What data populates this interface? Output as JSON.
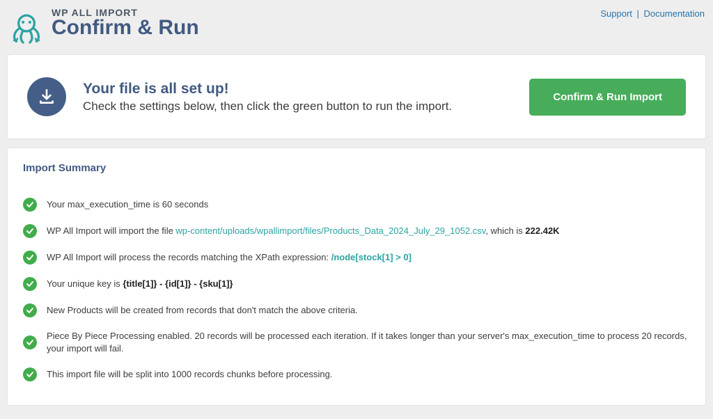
{
  "header": {
    "kicker": "WP ALL IMPORT",
    "title": "Confirm & Run",
    "support_label": "Support",
    "documentation_label": "Documentation",
    "separator": "|"
  },
  "setup": {
    "title": "Your file is all set up!",
    "subtitle": "Check the settings below, then click the green button to run the import.",
    "run_button_label": "Confirm & Run Import"
  },
  "summary": {
    "title": "Import Summary",
    "items": {
      "max_exec_pre": "Your max_execution_time is ",
      "max_exec_val": "60 seconds",
      "import_file_pre": "WP All Import will import the file ",
      "import_file_path": "wp-content/uploads/wpallimport/files/Products_Data_2024_July_29_1052.csv",
      "import_file_mid": ", which is ",
      "import_file_size": "222.42K",
      "xpath_pre": "WP All Import will process the records matching the XPath expression: ",
      "xpath_expr": "/node[stock[1] > 0]",
      "unique_pre": "Your unique key is ",
      "unique_key": "{title[1]} - {id[1]} - {sku[1]}",
      "new_products": "New Products will be created from records that don't match the above criteria.",
      "piece_processing": "Piece By Piece Processing enabled. 20 records will be processed each iteration. If it takes longer than your server's max_execution_time to process 20 records, your import will fail.",
      "chunks": "This import file will be split into 1000 records chunks before processing."
    }
  }
}
